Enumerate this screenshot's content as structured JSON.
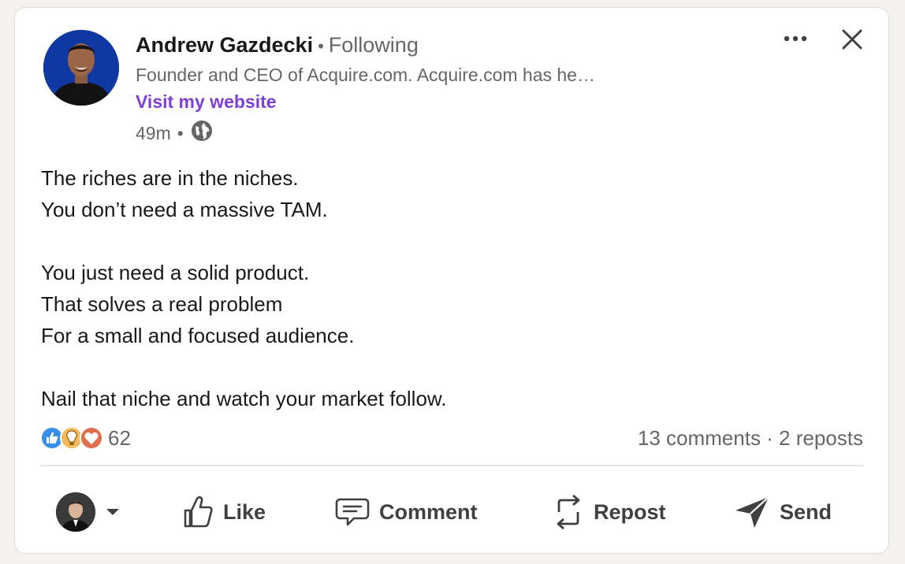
{
  "post": {
    "author": {
      "name": "Andrew Gazdecki",
      "separator": "•",
      "follow_status": "Following",
      "headline": "Founder and CEO of Acquire.com. Acquire.com has he…",
      "website_label": "Visit my website"
    },
    "meta": {
      "time": "49m",
      "separator": "•",
      "visibility_icon": "globe-icon"
    },
    "body_lines": [
      "The riches are in the niches.",
      "You don’t need a massive TAM.",
      "",
      "You just need a solid product.",
      "That solves a real problem",
      "For a small and focused audience.",
      "",
      "Nail that niche and watch your market follow."
    ],
    "reactions": {
      "icons": [
        "like-reaction-icon",
        "insightful-reaction-icon",
        "love-reaction-icon"
      ],
      "count": "62"
    },
    "social_counts": "13 comments · 2 reposts"
  },
  "actions": {
    "like": "Like",
    "comment": "Comment",
    "repost": "Repost",
    "send": "Send"
  },
  "colors": {
    "accent_purple": "#7f3fd6",
    "like_blue": "#378fe9",
    "insight_yellow": "#f5bb5c",
    "love_red": "#df704d",
    "muted_text": "#666666"
  }
}
